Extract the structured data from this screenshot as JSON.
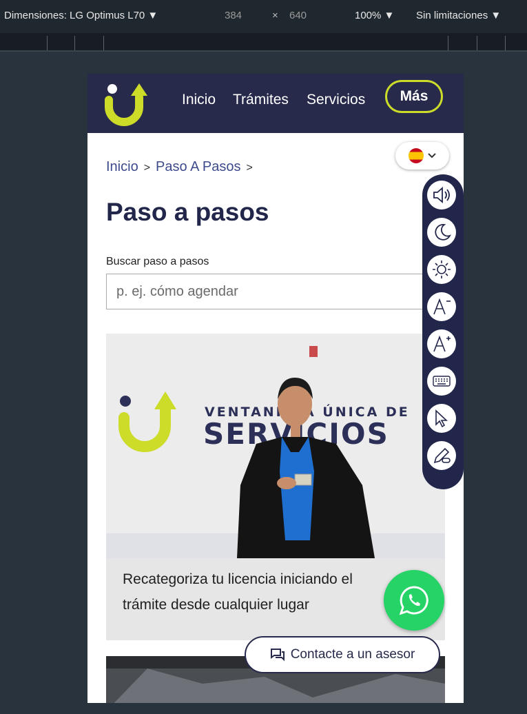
{
  "devtools": {
    "device_label": "Dimensiones: LG Optimus L70",
    "width": "384",
    "times": "×",
    "height": "640",
    "zoom": "100%",
    "throttle": "Sin limitaciones"
  },
  "nav": {
    "items": [
      "Inicio",
      "Trámites",
      "Servicios"
    ],
    "more": "Más"
  },
  "breadcrumb": {
    "home": "Inicio",
    "sep": ">",
    "current": "Paso A Pasos"
  },
  "page_title": "Paso a pasos",
  "search": {
    "label": "Buscar paso a pasos",
    "placeholder": "p. ej. cómo agendar"
  },
  "card": {
    "sign_line1": "VENTANILLA ÚNICA DE",
    "sign_line2": "SERVICIOS",
    "text": "Recategoriza tu licencia iniciando el trámite desde cualquier lugar"
  },
  "contact_label": "Contacte a un asesor",
  "accessibility_tools": [
    "speaker-icon",
    "moon-icon",
    "sun-icon",
    "font-decrease-icon",
    "font-increase-icon",
    "keyboard-icon",
    "cursor-icon",
    "pen-link-icon"
  ],
  "colors": {
    "navy": "#272a4b",
    "accent": "#cddc29",
    "whatsapp": "#25d366"
  }
}
